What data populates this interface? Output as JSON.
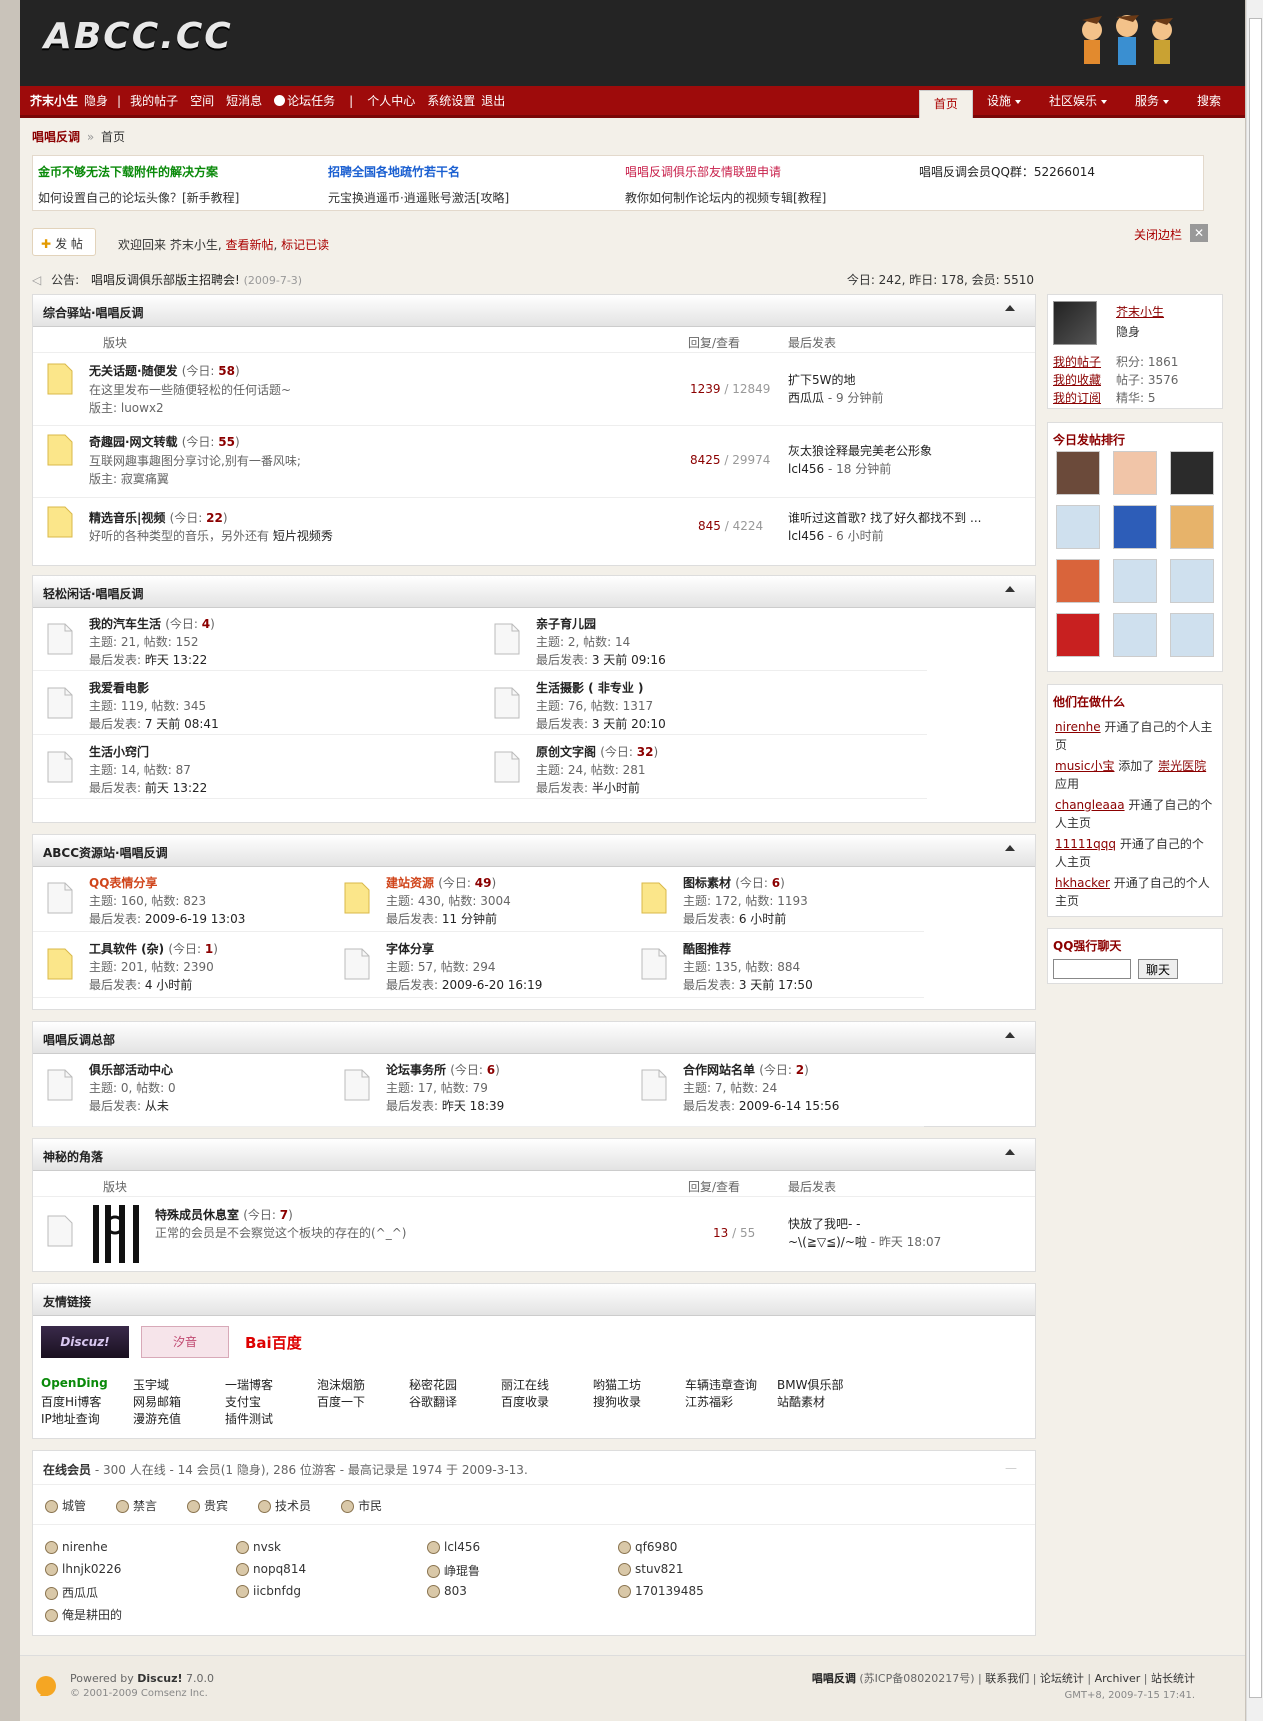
{
  "logo": "ABCC.CC",
  "menu": {
    "user": "芥末小生",
    "hidden": "隐身",
    "sep": "|",
    "items1": [
      "我的帖子",
      "空间",
      "短消息"
    ],
    "task": "论坛任务",
    "items2": [
      "个人中心",
      "系统设置",
      "退出"
    ],
    "right": [
      "首页",
      "设施",
      "社区娱乐",
      "服务",
      "搜索"
    ]
  },
  "breadcrumb": {
    "forum": "唱唱反调",
    "arrow": "»",
    "page": "首页"
  },
  "notices": [
    "金币不够无法下载附件的解决方案",
    "招聘全国各地疏竹若干名",
    "唱唱反调俱乐部友情联盟申请",
    "唱唱反调会员QQ群：52266014",
    "如何设置自己的论坛头像？[新手教程]",
    "元宝换逍遥币·逍遥账号激活[攻略]",
    "教你如何制作论坛内的视频专辑[教程]"
  ],
  "post_button": "发 帖",
  "welcome": {
    "prefix": "欢迎回来 芥末小生,",
    "new": "查看新帖",
    "mark": "标记已读"
  },
  "close_sidebar": "关闭边栏",
  "announce": {
    "label": "公告:",
    "text": "唱唱反调俱乐部版主招聘会!",
    "date": "(2009-7-3)",
    "stats": "今日: 242, 昨日: 178, 会员: 5510"
  },
  "col": {
    "board": "版块",
    "reply": "回复/查看",
    "last": "最后发表"
  },
  "cat1": {
    "title": "综合驿站·唱唱反调",
    "forums": [
      {
        "name": "无关话题·随便发",
        "today": "(今日: ",
        "n": "58",
        "desc": "在这里发布一些随便轻松的任何话题~",
        "mod": "版主: luowx2",
        "r": "1239",
        "v": " / 12849",
        "t1": "扩下5W的地",
        "t2": "西瓜瓜",
        "t3": " - 9 分钟前"
      },
      {
        "name": "奇趣园·网文转载",
        "today": "(今日: ",
        "n": "55",
        "desc": "互联网趣事趣图分享讨论,别有一番风味;",
        "mod": "版主: 寂寞痛翼",
        "r": "8425",
        "v": " / 29974",
        "t1": "灰太狼诠释最完美老公形象",
        "t2": "lcl456",
        "t3": " - 18 分钟前"
      },
      {
        "name": "精选音乐|视频",
        "today": "(今日: ",
        "n": "22",
        "desc": "好听的各种类型的音乐，另外还有",
        "desc2": "短片视频秀",
        "r": "845",
        "v": " / 4224",
        "t1": "谁听过这首歌? 找了好久都找不到 ...",
        "t2": "lcl456",
        "t3": " - 6 小时前"
      }
    ]
  },
  "cat2": {
    "title": "轻松闲话·唱唱反调",
    "forums": [
      {
        "name": "我的汽车生活",
        "today": "(今日: ",
        "n": "4",
        "stat": "主题: 21, 帖数: 152",
        "last": "最后发表: ",
        "lt": "昨天 13:22"
      },
      {
        "name": "亲子育儿园",
        "stat": "主题: 2, 帖数: 14",
        "last": "最后发表: ",
        "lt": "3 天前 09:16"
      },
      {
        "name": "我爱看电影",
        "stat": "主题: 119, 帖数: 345",
        "last": "最后发表: ",
        "lt": "7 天前 08:41"
      },
      {
        "name": "生活摄影 ( 非专业 )",
        "stat": "主题: 76, 帖数: 1317",
        "last": "最后发表: ",
        "lt": "3 天前 20:10"
      },
      {
        "name": "生活小窍门",
        "stat": "主题: 14, 帖数: 87",
        "last": "最后发表: ",
        "lt": "前天 13:22"
      },
      {
        "name": "原创文字阁",
        "today": "(今日: ",
        "n": "32",
        "stat": "主题: 24, 帖数: 281",
        "last": "最后发表: ",
        "lt": "半小时前"
      }
    ]
  },
  "cat3": {
    "title": "ABCC资源站·唱唱反调",
    "forums": [
      {
        "name": "QQ表情分享",
        "stat": "主题: 160, 帖数: 823",
        "last": "最后发表: ",
        "lt": "2009-6-19 13:03"
      },
      {
        "name": "建站资源",
        "today": "(今日: ",
        "n": "49",
        "stat": "主题: 430, 帖数: 3004",
        "last": "最后发表: ",
        "lt": "11 分钟前"
      },
      {
        "name": "图标素材",
        "today": "(今日: ",
        "n": "6",
        "stat": "主题: 172, 帖数: 1193",
        "last": "最后发表: ",
        "lt": "6 小时前"
      },
      {
        "name": "工具软件 (杂)",
        "today": "(今日: ",
        "n": "1",
        "stat": "主题: 201, 帖数: 2390",
        "last": "最后发表: ",
        "lt": "4 小时前"
      },
      {
        "name": "字体分享",
        "stat": "主题: 57, 帖数: 294",
        "last": "最后发表: ",
        "lt": "2009-6-20 16:19"
      },
      {
        "name": "酷图推荐",
        "stat": "主题: 135, 帖数: 884",
        "last": "最后发表: ",
        "lt": "3 天前 17:50"
      }
    ]
  },
  "cat4": {
    "title": "唱唱反调总部",
    "forums": [
      {
        "name": "俱乐部活动中心",
        "stat": "主题: 0, 帖数: 0",
        "last": "最后发表: ",
        "lt": "从未"
      },
      {
        "name": "论坛事务所",
        "today": "(今日: ",
        "n": "6",
        "stat": "主题: 17, 帖数: 79",
        "last": "最后发表: ",
        "lt": "昨天 18:39"
      },
      {
        "name": "合作网站名单",
        "today": "(今日: ",
        "n": "2",
        "stat": "主题: 7, 帖数: 24",
        "last": "最后发表: ",
        "lt": "2009-6-14 15:56"
      }
    ]
  },
  "cat5": {
    "title": "神秘的角落",
    "forum": {
      "name": "特殊成员休息室",
      "today": "(今日: ",
      "n": "7",
      "desc": "正常的会员是不会察觉这个板块的存在的(^_^)",
      "r": "13",
      "v": " / 55",
      "t1": "快放了我吧- -",
      "t2": "~\\(≧▽≦)/~啦",
      "t3": " - 昨天 18:07"
    }
  },
  "links": {
    "title": "友情链接",
    "logos": [
      "Discuz!",
      "汐音",
      "Bai百度"
    ],
    "rows": [
      [
        "OpenDing",
        "玉宇域",
        "一瑞博客",
        "泡沫烟筋",
        "秘密花园",
        "丽江在线",
        "哟猫工坊",
        "车辆违章查询",
        "BMW俱乐部"
      ],
      [
        "百度Hi博客",
        "网易邮箱",
        "支付宝",
        "百度一下",
        "谷歌翻译",
        "百度收录",
        "搜狗收录",
        "江苏福彩",
        "站酷素材"
      ],
      [
        "IP地址查询",
        "漫游充值",
        "插件测试"
      ]
    ]
  },
  "online": {
    "title": "在线会员",
    "summary": " - 300 人在线 - 14 会员(1 隐身), 286 位游客 - 最高记录是 1974 于 2009-3-13.",
    "roles": [
      "城管",
      "禁言",
      "贵宾",
      "技术员",
      "市民"
    ],
    "users": [
      "nirenhe",
      "nvsk",
      "lcl456",
      "qf6980",
      "lhnjk0226",
      "nopq814",
      "峥琨鲁",
      "stuv821",
      "西瓜瓜",
      "iicbnfdg",
      "803",
      "170139485",
      "俺是耕田的"
    ]
  },
  "profile": {
    "name": "芥末小生",
    "status": "隐身",
    "links": [
      "我的帖子",
      "我的收藏",
      "我的订阅"
    ],
    "stats": [
      "积分: 1861",
      "帖子: 3576",
      "精华: 5"
    ]
  },
  "rank_title": "今日发帖排行",
  "activity": {
    "title": "他们在做什么",
    "items": [
      {
        "u": "nirenhe",
        "t": " 开通了自己的个人主页"
      },
      {
        "u": "music小宝",
        "t": " 添加了 ",
        "u2": "崇光医院",
        "t2": " 应用"
      },
      {
        "u": "changleaaa",
        "t": " 开通了自己的个人主页"
      },
      {
        "u": "11111qqq",
        "t": " 开通了自己的个人主页"
      },
      {
        "u": "hkhacker",
        "t": " 开通了自己的个人主页"
      }
    ]
  },
  "qq": {
    "title": "QQ强行聊天",
    "button": "聊天"
  },
  "footer": {
    "powered": "Powered by ",
    "discuz": "Discuz!",
    "ver": " 7.0.0",
    "copy": "© 2001-2009 Comsenz Inc.",
    "site": "唱唱反调",
    "icp": " (苏ICP备08020217号) ",
    "links": [
      "联系我们",
      "论坛统计",
      "Archiver",
      "站长统计"
    ],
    "time": "GMT+8, 2009-7-15 17:41."
  },
  "colors": {
    "brand": "#9e0b0b",
    "link": "#8b0000"
  }
}
